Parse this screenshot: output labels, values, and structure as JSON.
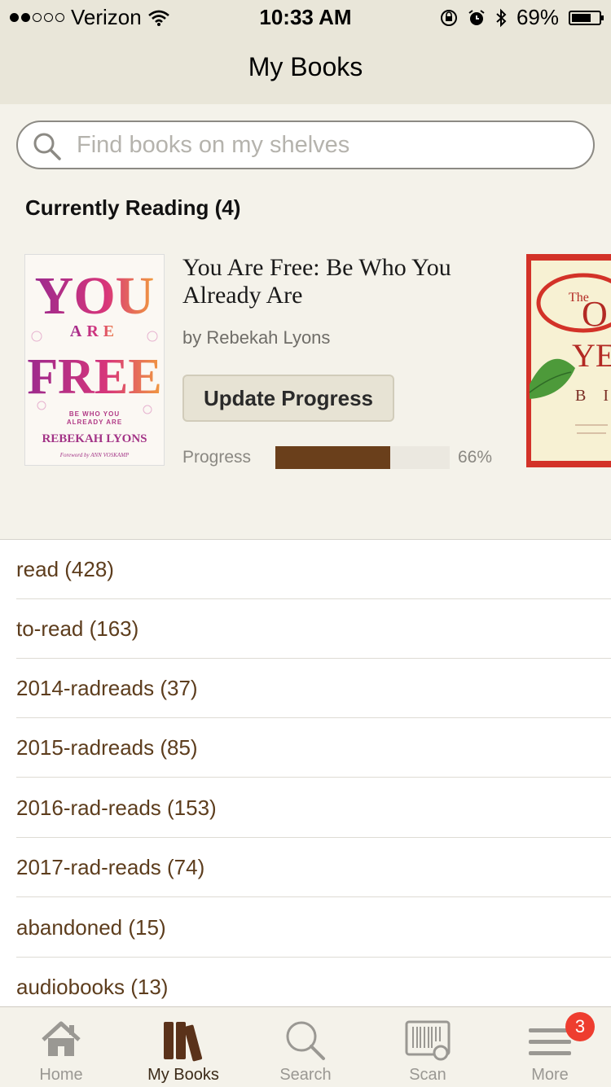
{
  "status_bar": {
    "carrier": "Verizon",
    "time": "10:33 AM",
    "battery": "69%",
    "signal_dots_filled": 2,
    "signal_dots_total": 5,
    "battery_level": 0.69,
    "icons": [
      "wifi-icon",
      "orientation-lock-icon",
      "alarm-icon",
      "bluetooth-icon",
      "battery-icon"
    ]
  },
  "nav": {
    "title": "My Books"
  },
  "search": {
    "placeholder": "Find books on my shelves"
  },
  "currently_reading": {
    "heading": "Currently Reading (4)",
    "book": {
      "title": "You Are Free: Be Who You Already Are",
      "author": "by Rebekah Lyons",
      "update_button": "Update Progress",
      "progress_label": "Progress",
      "progress_pct": "66%",
      "progress_value": 0.66,
      "cover": {
        "line1": "YOU",
        "line2": "ARE",
        "line3": "FREE",
        "tagline1": "BE WHO YOU",
        "tagline2": "ALREADY ARE",
        "author": "REBEKAH LYONS",
        "foreword": "Foreword by ANN VOSKAMP"
      }
    },
    "next_cover": {
      "line1": "The",
      "line2": "O",
      "line3": "YE",
      "line4": "B I"
    }
  },
  "shelves": [
    {
      "label": "read (428)"
    },
    {
      "label": "to-read (163)"
    },
    {
      "label": "2014-radreads (37)"
    },
    {
      "label": "2015-radreads (85)"
    },
    {
      "label": "2016-rad-reads (153)"
    },
    {
      "label": "2017-rad-reads (74)"
    },
    {
      "label": "abandoned (15)"
    },
    {
      "label": "audiobooks (13)"
    }
  ],
  "tabs": [
    {
      "label": "Home",
      "icon": "home-icon",
      "active": false
    },
    {
      "label": "My Books",
      "icon": "books-icon",
      "active": true
    },
    {
      "label": "Search",
      "icon": "search-icon",
      "active": false
    },
    {
      "label": "Scan",
      "icon": "barcode-scan-icon",
      "active": false
    },
    {
      "label": "More",
      "icon": "menu-icon",
      "active": false,
      "badge": "3"
    }
  ],
  "colors": {
    "accent_brown": "#6a3f1b",
    "shelf_text": "#5d3d1d",
    "badge_red": "#ee3d2f",
    "header_bg": "#e9e6d9"
  }
}
